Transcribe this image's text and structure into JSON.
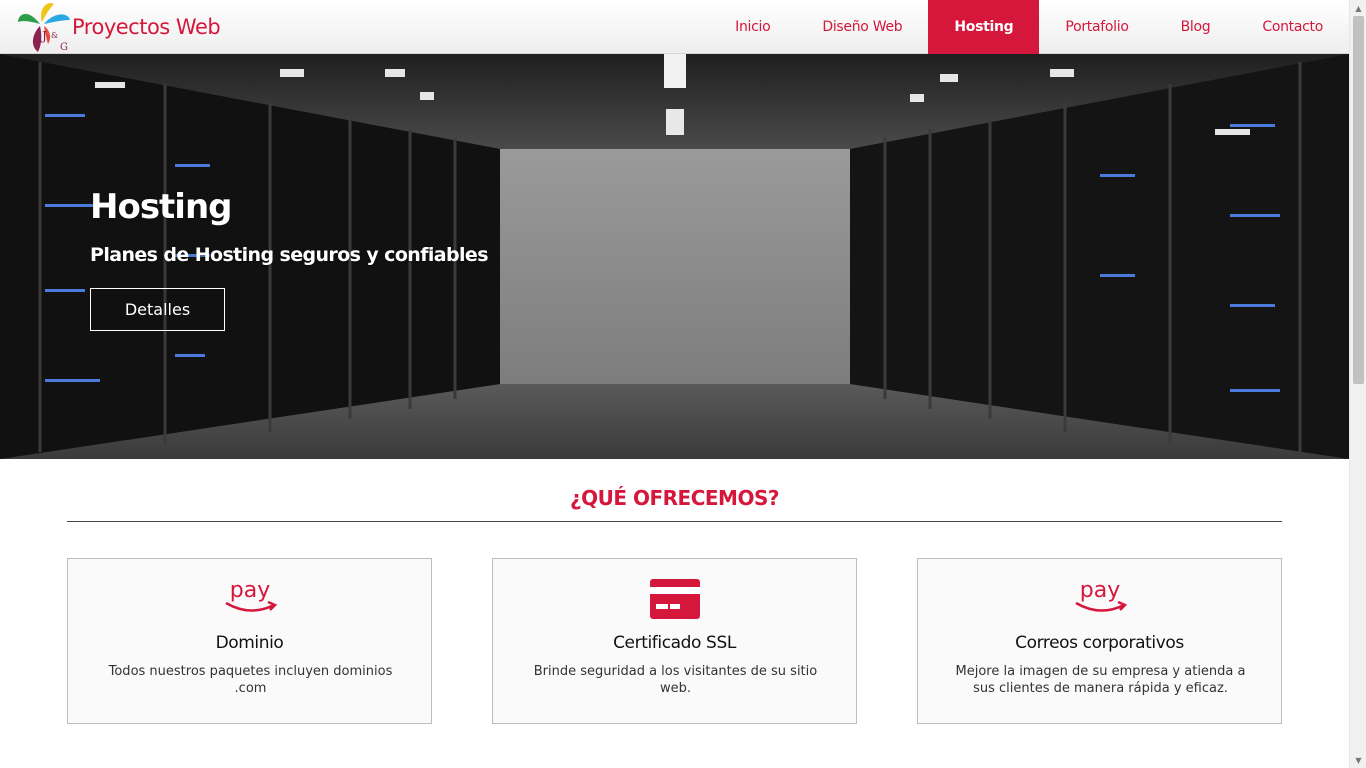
{
  "brand": {
    "name": "Proyectos Web",
    "logo_letters": "J&G",
    "accent": "#d6173c"
  },
  "nav": {
    "items": [
      {
        "label": "Inicio",
        "active": false
      },
      {
        "label": "Diseño Web",
        "active": false
      },
      {
        "label": "Hosting",
        "active": true
      },
      {
        "label": "Portafolio",
        "active": false
      },
      {
        "label": "Blog",
        "active": false
      },
      {
        "label": "Contacto",
        "active": false
      }
    ]
  },
  "hero": {
    "title": "Hosting",
    "subtitle": "Planes de Hosting seguros y confiables",
    "button_label": "Detalles",
    "background": "server-room-image"
  },
  "section": {
    "title": "¿QUÉ OFRECEMOS?"
  },
  "cards": [
    {
      "icon": "amazon-pay-icon",
      "icon_text": "pay",
      "title": "Dominio",
      "description": "Todos nuestros paquetes incluyen dominios .com"
    },
    {
      "icon": "credit-card-icon",
      "title": "Certificado SSL",
      "description": "Brinde seguridad a los visitantes de su sitio web."
    },
    {
      "icon": "amazon-pay-icon",
      "icon_text": "pay",
      "title": "Correos corporativos",
      "description": "Mejore la imagen de su empresa y atienda a sus clientes de manera rápida y eficaz."
    }
  ]
}
